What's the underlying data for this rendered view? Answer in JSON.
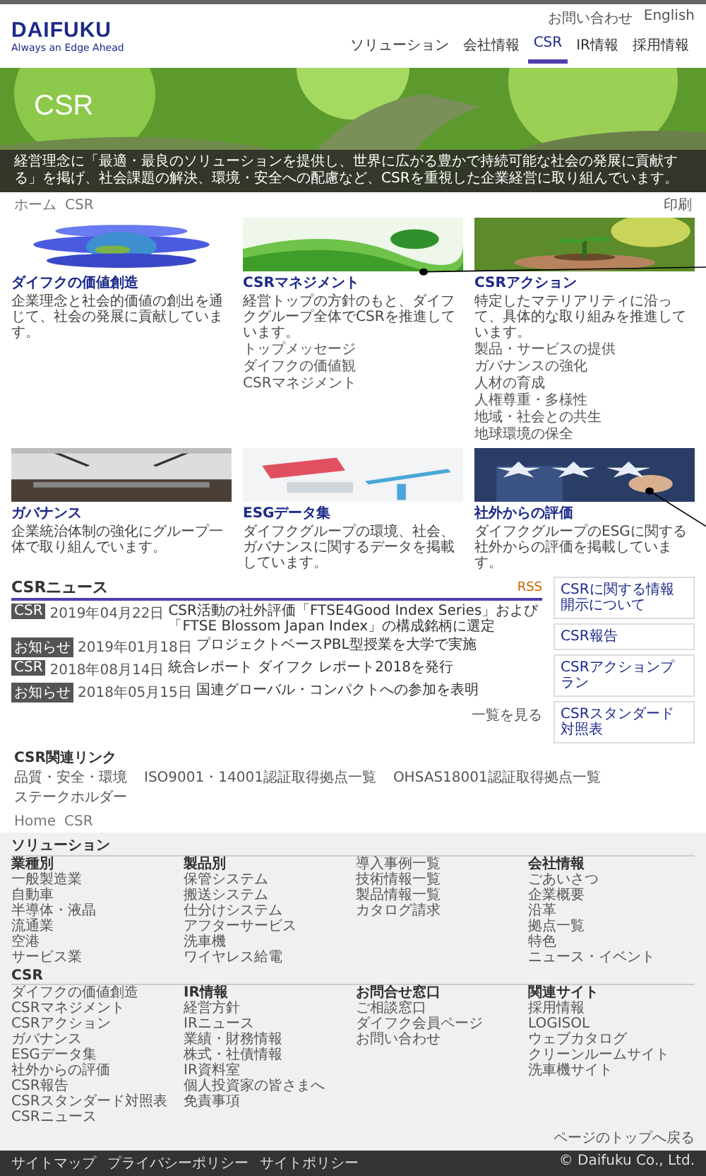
{
  "header": {
    "logo": "DAIFUKU",
    "tagline": "Always an Edge Ahead",
    "utility": [
      "お問い合わせ",
      "English"
    ],
    "nav": [
      {
        "label": "ソリューション",
        "selected": false
      },
      {
        "label": "会社情報",
        "selected": false
      },
      {
        "label": "CSR",
        "selected": true
      },
      {
        "label": "IR情報",
        "selected": false
      },
      {
        "label": "採用情報",
        "selected": false
      }
    ]
  },
  "hero": {
    "title": "CSR",
    "caption": "経営理念に「最適・最良のソリューションを提供し、世界に広がる豊かで持続可能な社会の発展に貢献する」を掲げ、社会課題の解決、環境・安全への配慮など、CSRを重視した企業経営に取り組んでいます。"
  },
  "breadcrumb": [
    "ホーム",
    "CSR"
  ],
  "print": "印刷",
  "cards": [
    {
      "title": "ダイフクの価値創造",
      "description": "企業理念と社会的価値の創出を通じて、社会の発展に貢献しています。"
    },
    {
      "title": "CSRマネジメント",
      "description": "経営トップの方針のもと、ダイフクグループ全体でCSRを推進しています。",
      "links": [
        "トップメッセージ",
        "ダイフクの価値観",
        "CSRマネジメント"
      ]
    },
    {
      "title": "CSRアクション",
      "description": "特定したマテリアリティに沿って、具体的な取り組みを推進しています。",
      "links": [
        "製品・サービスの提供",
        "ガバナンスの強化",
        "人材の育成",
        "人権尊重・多様性",
        "地域・社会との共生",
        "地球環境の保全"
      ]
    },
    {
      "title": "ガバナンス",
      "description": "企業統治体制の強化にグループ一体で取り組んでいます。"
    },
    {
      "title": "ESGデータ集",
      "description": "ダイフクグループの環境、社会、ガバナンスに関するデータを掲載しています。"
    },
    {
      "title": "社外からの評価",
      "description": "ダイフクグループのESGに関する社外からの評価を掲載しています。"
    }
  ],
  "news": {
    "title": "CSRニュース",
    "rss": "RSS",
    "more": "一覧を見る",
    "items": [
      {
        "tag": "CSR",
        "date": "2019年04月22日",
        "text": "CSR活動の社外評価「FTSE4Good Index Series」および「FTSE Blossom Japan Index」の構成銘柄に選定"
      },
      {
        "tag": "お知らせ",
        "date": "2019年01月18日",
        "text": "プロジェクトベースPBL型授業を大学で実施"
      },
      {
        "tag": "CSR",
        "date": "2018年08月14日",
        "text": "統合レポート ダイフク レポート2018を発行"
      },
      {
        "tag": "お知らせ",
        "date": "2018年05月15日",
        "text": "国連グローバル・コンパクトへの参加を表明"
      }
    ]
  },
  "side_links": [
    "CSRに関する情報開示について",
    "CSR報告",
    "CSRアクションプラン",
    "CSRスタンダード対照表"
  ],
  "related": {
    "title": "CSR関連リンク",
    "links": [
      "品質・安全・環境",
      "ISO9001・14001認証取得拠点一覧",
      "OHSAS18001認証取得拠点一覧",
      "ステークホルダー"
    ]
  },
  "footer_breadcrumb": [
    "Home",
    "CSR"
  ],
  "footer": [
    {
      "title": "ソリューション",
      "columns": [
        {
          "heading": "業種別",
          "items": [
            "一般製造業",
            "自動車",
            "半導体・液晶",
            "流通業",
            "空港",
            "サービス業"
          ]
        },
        {
          "heading": "製品別",
          "items": [
            "保管システム",
            "搬送システム",
            "仕分けシステム",
            "アフターサービス",
            "洗車機",
            "ワイヤレス給電"
          ]
        },
        {
          "items": [
            "導入事例一覧",
            "技術情報一覧",
            "製品情報一覧",
            "カタログ請求"
          ]
        },
        {
          "heading": "会社情報",
          "items": [
            "ごあいさつ",
            "企業概要",
            "沿革",
            "拠点一覧",
            "特色",
            "ニュース・イベント"
          ]
        }
      ]
    },
    {
      "title": "CSR",
      "columns": [
        {
          "items": [
            "ダイフクの価値創造",
            "CSRマネジメント",
            "CSRアクション",
            "ガバナンス",
            "ESGデータ集",
            "社外からの評価",
            "CSR報告",
            "CSRスタンダード対照表",
            "CSRニュース"
          ]
        },
        {
          "heading": "IR情報",
          "items": [
            "経営方針",
            "IRニュース",
            "業績・財務情報",
            "株式・社債情報",
            "IR資料室",
            "個人投資家の皆さまへ",
            "免責事項"
          ]
        },
        {
          "heading": "お問合せ窓口",
          "items": [
            "ご相談窓口",
            "ダイフク会員ページ",
            "お問い合わせ"
          ]
        },
        {
          "heading": "関連サイト",
          "items": [
            "採用情報",
            "LOGISOL",
            "ウェブカタログ",
            "クリーンルームサイト",
            "洗車機サイト"
          ]
        }
      ]
    }
  ],
  "page_top": "ページのトップへ戻る",
  "bottom": {
    "links": [
      "サイトマップ",
      "プライバシーポリシー",
      "サイトポリシー"
    ],
    "copyright": "© Daifuku Co., Ltd."
  }
}
